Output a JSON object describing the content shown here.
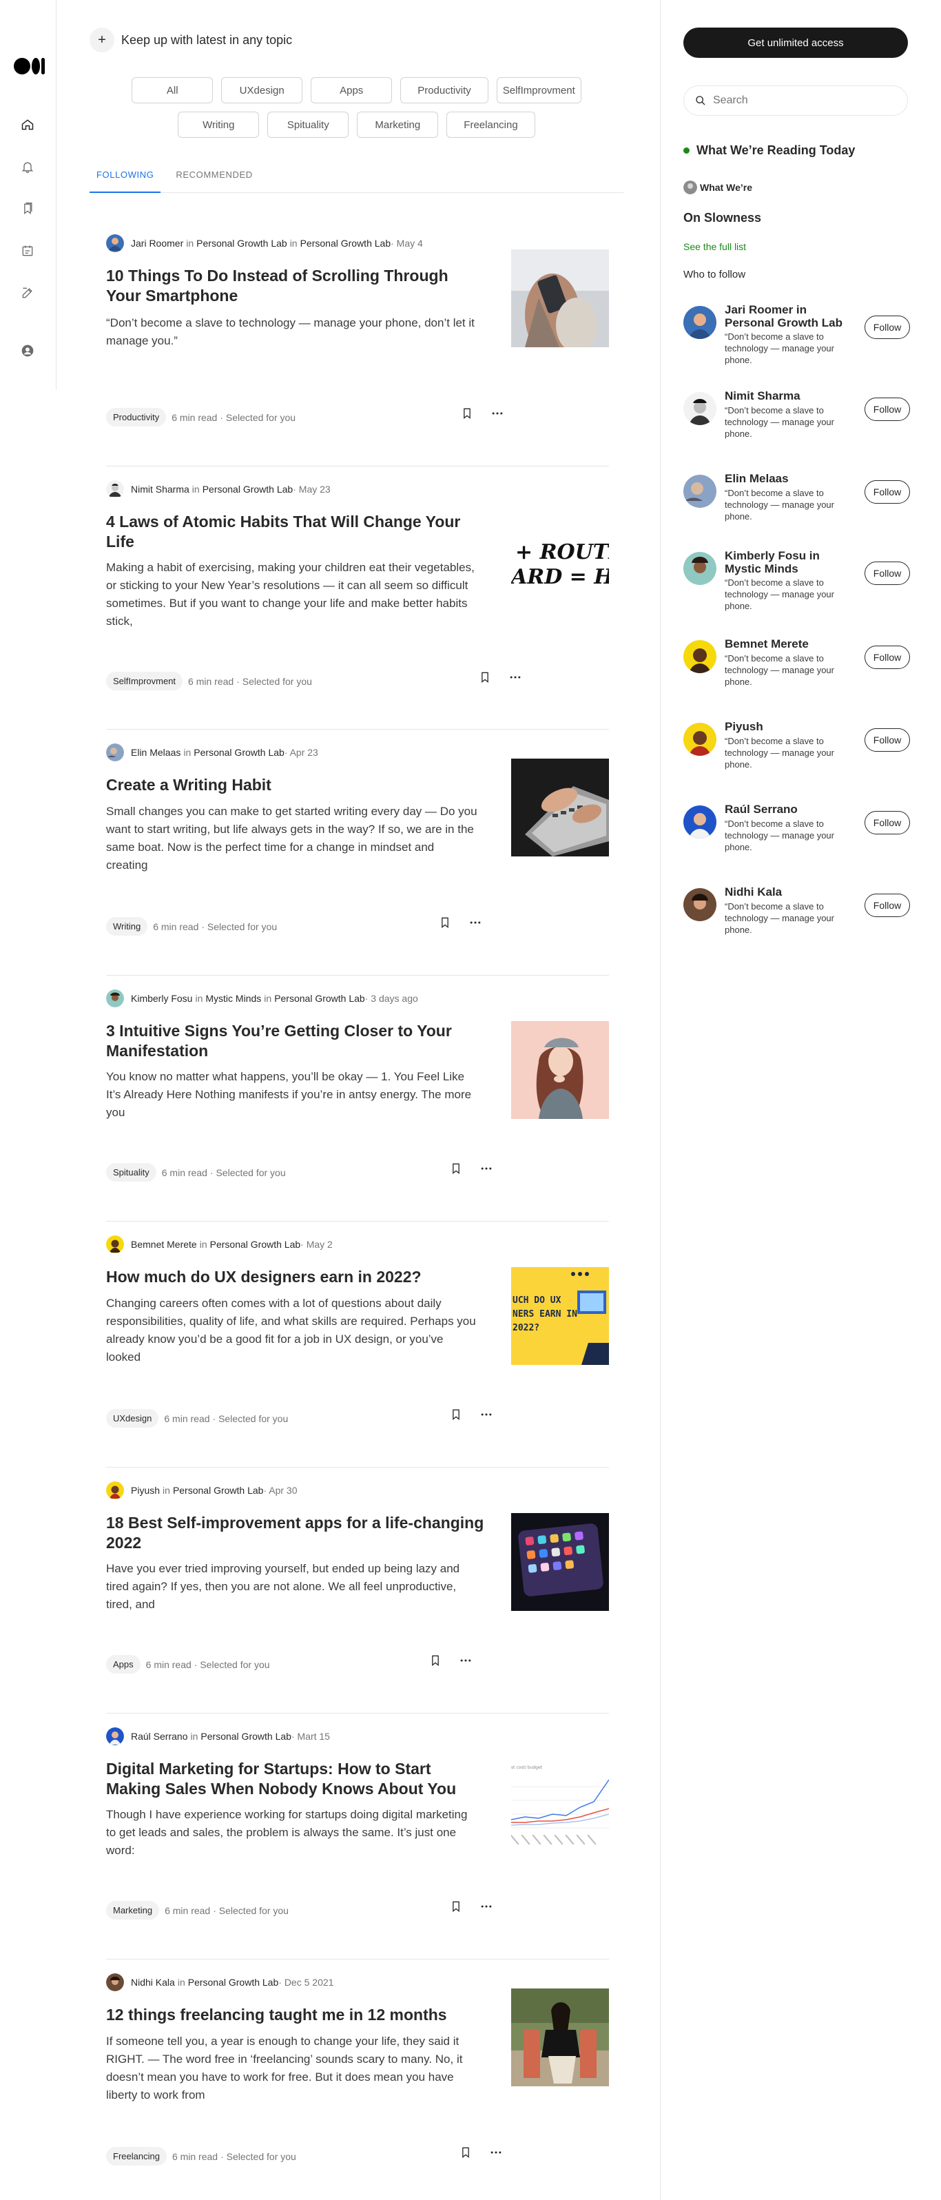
{
  "topics_prompt": "Keep up with latest in any topic",
  "chips_row1": [
    "All",
    "UXdesign",
    "Apps",
    "Productivity",
    "SelfImprovment"
  ],
  "chips_row2": [
    "Writing",
    "Spituality",
    "Marketing",
    "Freelancing"
  ],
  "tabs": [
    "FOLLOWING",
    "RECOMMENDED"
  ],
  "articles": [
    {
      "author": "Jari Roomer",
      "in": "in",
      "pub1": "Personal Growth Lab",
      "in2": "in",
      "pub2": "Personal Growth Lab",
      "date": "· May 4",
      "title": "10 Things To Do Instead of Scrolling Through Your Smartphone",
      "excerpt": "“Don’t become a slave to technology — manage your phone, don’t let it manage you.”",
      "tag": "Productivity",
      "readtime": "6 min read",
      "selected": "· Selected for you"
    },
    {
      "author": "Nimit Sharma",
      "in": "in",
      "pub1": "Personal Growth Lab",
      "date": "· May 23",
      "title": "4 Laws of Atomic Habits That Will Change Your Life",
      "excerpt": "Making a habit of exercising, making your children eat their vegetables, or sticking to your New Year’s resolutions — it can all seem so difficult sometimes. But if you want to change your life and make better habits stick,",
      "tag": "SelfImprovment",
      "readtime": "6 min read",
      "selected": "· Selected for you"
    },
    {
      "author": "Elin Melaas",
      "in": "in",
      "pub1": "Personal Growth Lab",
      "date": "· Apr 23",
      "title": "Create a Writing Habit",
      "excerpt": "Small changes you can make to get started writing every day — Do you want to start writing, but life always gets in the way? If so, we are in the same boat. Now is the perfect time for a change in mindset and creating",
      "tag": "Writing",
      "readtime": "6 min read",
      "selected": "· Selected for you"
    },
    {
      "author": "Kimberly Fosu",
      "in": "in",
      "pub0": "Mystic Minds",
      "in2": "in",
      "pub1": "Personal Growth Lab",
      "date": "· 3 days ago",
      "title": "3 Intuitive Signs You’re Getting Closer to Your Manifestation",
      "excerpt": "You know no matter what happens, you’ll be okay — 1. You Feel Like It’s Already Here Nothing manifests if you’re in antsy energy. The more you",
      "tag": "Spituality",
      "readtime": "6 min read",
      "selected": "· Selected for you"
    },
    {
      "author": "Bemnet Merete",
      "in": "in",
      "pub1": "Personal Growth Lab",
      "date": "· May 2",
      "title": "How much do UX designers earn in 2022?",
      "excerpt": "Changing careers often comes with a lot of questions about daily responsibilities, quality of life, and what skills are required. Perhaps you already know you’d be a good fit for a job in UX design, or you’ve looked",
      "tag": "UXdesign",
      "readtime": "6 min read",
      "selected": "· Selected for you"
    },
    {
      "author": "Piyush",
      "in": "in",
      "pub1": "Personal Growth Lab",
      "date": "· Apr 30",
      "title": "18 Best Self-improvement apps for a life-changing 2022",
      "excerpt": "Have you ever tried improving yourself, but ended up being lazy and tired again? If yes, then you are not alone. We all feel unproductive, tired, and",
      "tag": "Apps",
      "readtime": "6 min read",
      "selected": "· Selected for you"
    },
    {
      "author": "Raúl Serrano",
      "in": "in",
      "pub1": "Personal Growth Lab",
      "date": "· Mart 15",
      "title": "Digital Marketing for Startups: How to Start Making Sales When Nobody Knows About You",
      "excerpt": "Though I have experience working for startups doing digital marketing to get leads and sales, the problem is always the same. It’s just one word:",
      "tag": "Marketing",
      "readtime": "6 min read",
      "selected": "· Selected for you"
    },
    {
      "author": "Nidhi Kala",
      "in": "in",
      "pub1": "Personal Growth Lab",
      "date": "· Dec 5 2021",
      "title": "12 things freelancing taught me in 12 months",
      "excerpt": "If someone tell you, a year is enough to change your life, they said it RIGHT. — The word free in ‘freelancing’ sounds scary to many. No, it doesn’t mean you have to work for free. But it does mean you have liberty to work from",
      "tag": "Freelancing",
      "readtime": "6 min read",
      "selected": "· Selected for you"
    }
  ],
  "thumb_texts": {
    "habits_line1": "+ ROUTI",
    "habits_line2": "ARD = H",
    "ux_line1": "UCH DO UX",
    "ux_line2": "NERS EARN IN",
    "ux_line3": "2022?",
    "chart_caption": "st cost/ budget"
  },
  "sidebar": {
    "cta": "Get unlimited access",
    "search_placeholder": "Search",
    "reading_today": "What We’re Reading Today",
    "what_were": "What We’re",
    "on_slowness": "On Slowness",
    "see_full_list": "See the full list",
    "who_to_follow": "Who to follow",
    "follow_label": "Follow",
    "people": [
      {
        "name": "Jari Roomer in Personal Growth Lab",
        "desc": "“Don’t become a slave to technology — manage your phone."
      },
      {
        "name": "Nimit Sharma",
        "desc": "“Don’t become a slave to technology — manage your phone."
      },
      {
        "name": "Elin Melaas",
        "desc": "“Don’t become a slave to technology — manage your phone."
      },
      {
        "name": "Kimberly Fosu in Mystic Minds",
        "desc": "“Don’t become a slave to technology — manage your phone."
      },
      {
        "name": "Bemnet Merete",
        "desc": "“Don’t become a slave to technology — manage your phone."
      },
      {
        "name": "Piyush",
        "desc": "“Don’t become a slave to technology — manage your phone."
      },
      {
        "name": "Raúl Serrano",
        "desc": "“Don’t become a slave to technology — manage your phone."
      },
      {
        "name": "Nidhi Kala",
        "desc": "“Don’t become a slave to technology — manage your phone."
      }
    ]
  },
  "colors": {
    "accent_green": "#1a8917",
    "tab_active": "#1a73e8",
    "cta_bg": "#191919"
  }
}
